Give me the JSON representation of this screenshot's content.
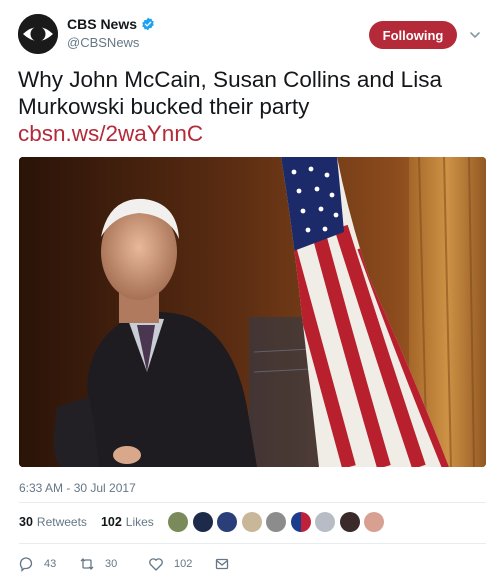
{
  "account": {
    "name": "CBS News",
    "handle": "@CBSNews",
    "avatar_icon": "cbs-eye-logo",
    "verified_icon": "verified-badge-icon",
    "follow_label": "Following"
  },
  "tweet": {
    "text": "Why John McCain, Susan Collins and Lisa Murkowski bucked their party ",
    "link": "cbsn.ws/2waYnnC",
    "photo": "photo"
  },
  "meta": {
    "timestamp": "6:33 AM - 30 Jul 2017"
  },
  "stats": {
    "retweets_count": "30",
    "retweets_label": "Retweets",
    "likes_count": "102",
    "likes_label": "Likes"
  },
  "actions": {
    "reply_count": "43",
    "retweet_count": "30",
    "like_count": "102"
  },
  "colors": {
    "accent": "#b42a38",
    "muted": "#657786",
    "verified": "#1da1f2"
  }
}
